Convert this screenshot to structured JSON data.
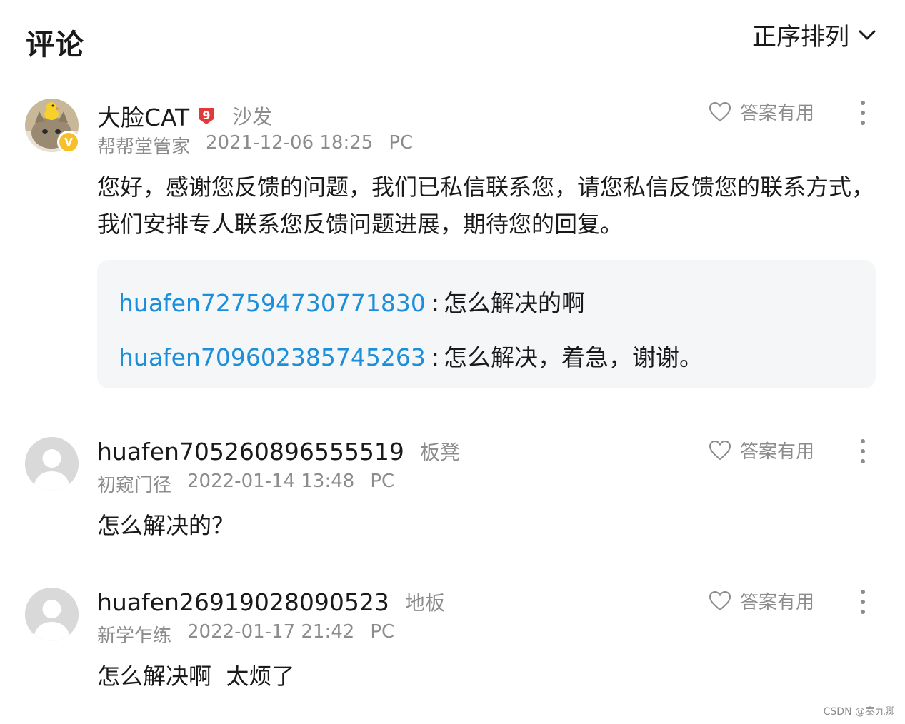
{
  "header": {
    "title": "评论",
    "sort_label": "正序排列"
  },
  "comments": [
    {
      "user": "大脸CAT",
      "level_badge": "9",
      "floor": "沙发",
      "rank": "帮帮堂管家",
      "time": "2021-12-06 18:25",
      "device": "PC",
      "helpful_label": "答案有用",
      "text": "您好，感谢您反馈的问题，我们已私信联系您，请您私信反馈您的联系方式，我们安排专人联系您反馈问题进展，期待您的回复。",
      "verified": "V",
      "replies": [
        {
          "user": "huafen727594730771830",
          "colon": ":",
          "text": "怎么解决的啊"
        },
        {
          "user": "huafen709602385745263",
          "colon": ":",
          "text": "怎么解决，着急，谢谢。"
        }
      ]
    },
    {
      "user": "huafen705260896555519",
      "floor": "板凳",
      "rank": "初窥门径",
      "time": "2022-01-14 13:48",
      "device": "PC",
      "helpful_label": "答案有用",
      "text": "怎么解决的？"
    },
    {
      "user": "huafen26919028090523",
      "floor": "地板",
      "rank": "新学乍练",
      "time": "2022-01-17 21:42",
      "device": "PC",
      "helpful_label": "答案有用",
      "text": "怎么解决啊  太烦了"
    }
  ],
  "watermark": "CSDN @秦九卿",
  "colors": {
    "link": "#1b8fd9",
    "meta": "#8c8c8c",
    "reply_bg": "#f5f6f7",
    "badge_yellow": "#f6c02b",
    "level_red": "#e03b3b"
  }
}
